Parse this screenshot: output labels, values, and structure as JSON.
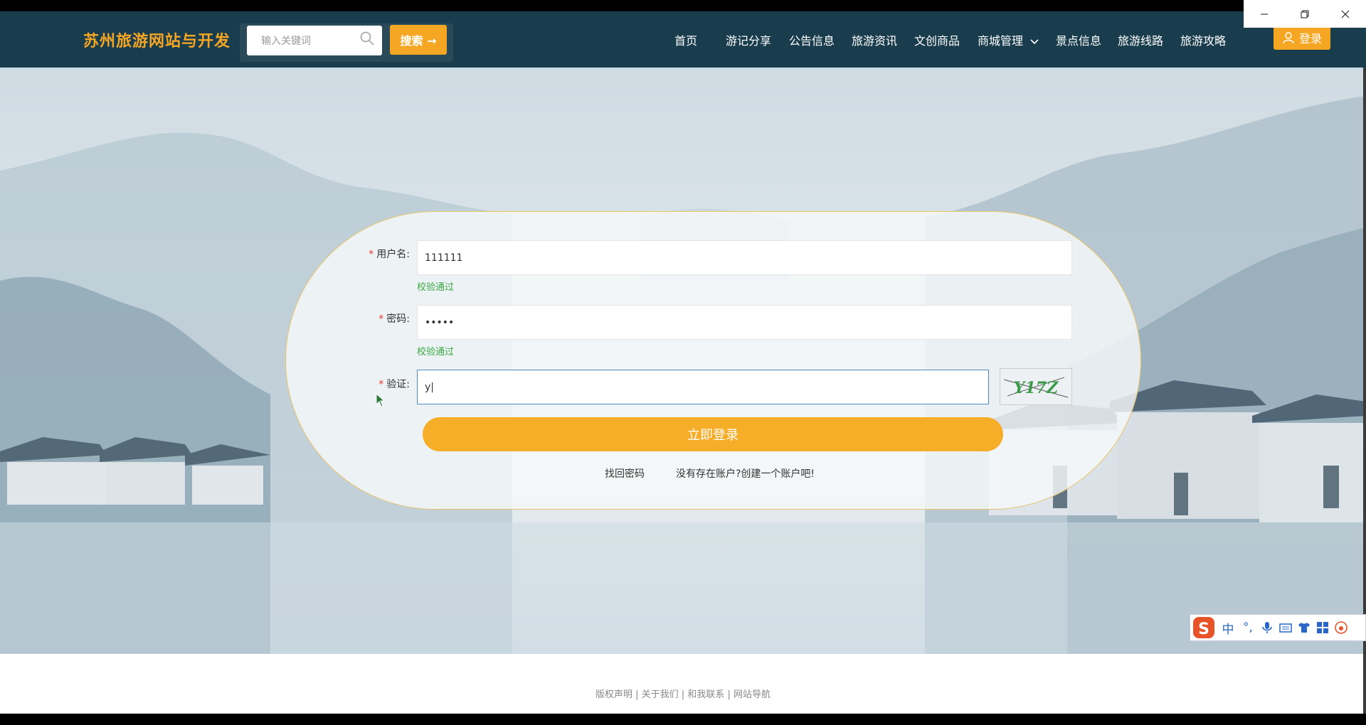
{
  "site": {
    "brand": "苏州旅游网站与开发"
  },
  "search": {
    "placeholder": "输入关键词",
    "button": "搜索 →"
  },
  "nav": {
    "items": [
      "首页",
      "游记分享",
      "公告信息",
      "旅游资讯",
      "文创商品",
      "商城管理",
      "景点信息",
      "旅游线路",
      "旅游攻略"
    ],
    "login": "登录"
  },
  "form": {
    "username_label": "用户名:",
    "username_value": "111111",
    "username_valid": "校验通过",
    "password_label": "密码:",
    "password_value": "•••••",
    "password_valid": "校验通过",
    "captcha_label": "验证:",
    "captcha_value": "y|",
    "captcha_text": "Y17Z",
    "submit": "立即登录",
    "forgot": "找回密码",
    "register": "没有存在账户?创建一个账户吧!"
  },
  "footer": {
    "text": "版权声明 | 关于我们 | 和我联系 | 网站导航"
  },
  "ime": {
    "keys": [
      "中",
      "°,"
    ]
  },
  "colors": {
    "nav_bg": "#1a3d4e",
    "accent": "#f5a623",
    "valid": "#3aa845"
  }
}
